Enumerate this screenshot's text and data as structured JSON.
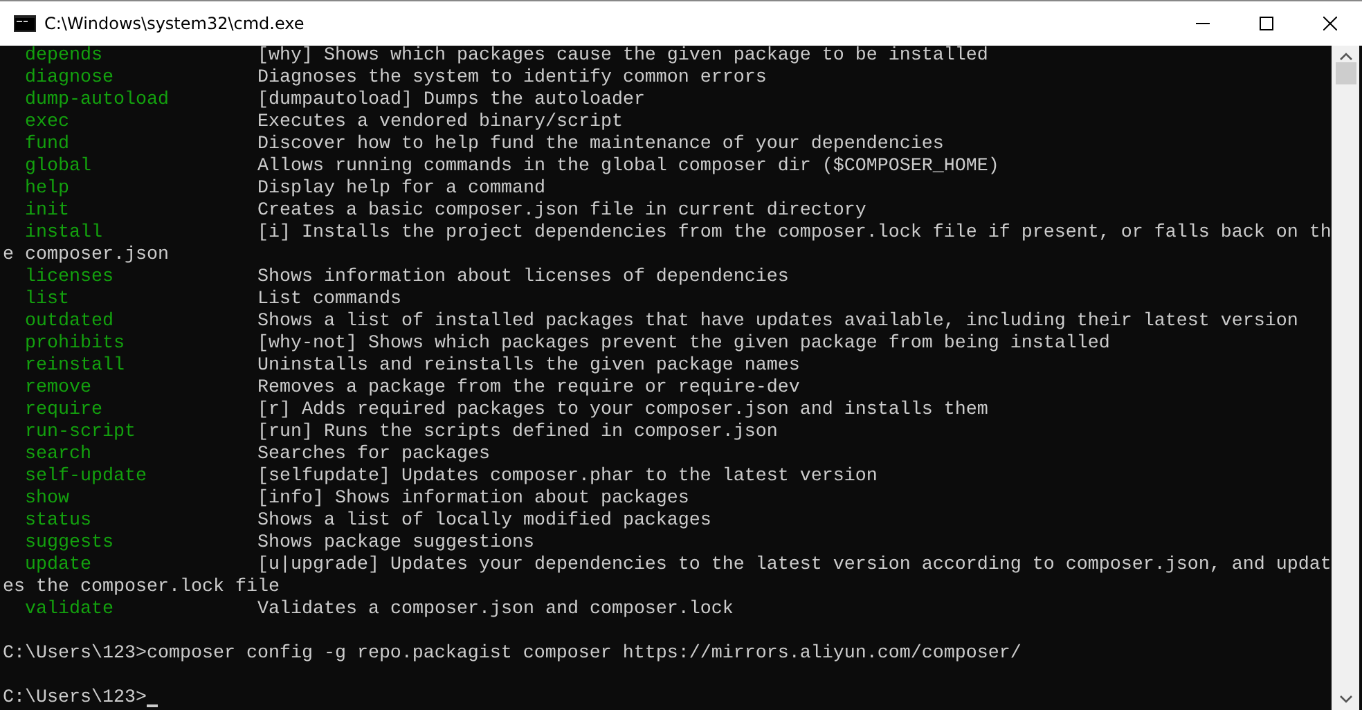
{
  "window": {
    "title": "C:\\Windows\\system32\\cmd.exe"
  },
  "console": {
    "lines": [
      {
        "kind": "command",
        "name": "depends",
        "description": "[why] Shows which packages cause the given package to be installed"
      },
      {
        "kind": "command",
        "name": "diagnose",
        "description": "Diagnoses the system to identify common errors"
      },
      {
        "kind": "command",
        "name": "dump-autoload",
        "description": "[dumpautoload] Dumps the autoloader"
      },
      {
        "kind": "command",
        "name": "exec",
        "description": "Executes a vendored binary/script"
      },
      {
        "kind": "command",
        "name": "fund",
        "description": "Discover how to help fund the maintenance of your dependencies"
      },
      {
        "kind": "command",
        "name": "global",
        "description": "Allows running commands in the global composer dir ($COMPOSER_HOME)"
      },
      {
        "kind": "command",
        "name": "help",
        "description": "Display help for a command"
      },
      {
        "kind": "command",
        "name": "init",
        "description": "Creates a basic composer.json file in current directory"
      },
      {
        "kind": "command",
        "name": "install",
        "description": "[i] Installs the project dependencies from the composer.lock file if present, or falls back on th"
      },
      {
        "kind": "text",
        "text": "e composer.json"
      },
      {
        "kind": "command",
        "name": "licenses",
        "description": "Shows information about licenses of dependencies"
      },
      {
        "kind": "command",
        "name": "list",
        "description": "List commands"
      },
      {
        "kind": "command",
        "name": "outdated",
        "description": "Shows a list of installed packages that have updates available, including their latest version"
      },
      {
        "kind": "command",
        "name": "prohibits",
        "description": "[why-not] Shows which packages prevent the given package from being installed"
      },
      {
        "kind": "command",
        "name": "reinstall",
        "description": "Uninstalls and reinstalls the given package names"
      },
      {
        "kind": "command",
        "name": "remove",
        "description": "Removes a package from the require or require-dev"
      },
      {
        "kind": "command",
        "name": "require",
        "description": "[r] Adds required packages to your composer.json and installs them"
      },
      {
        "kind": "command",
        "name": "run-script",
        "description": "[run] Runs the scripts defined in composer.json"
      },
      {
        "kind": "command",
        "name": "search",
        "description": "Searches for packages"
      },
      {
        "kind": "command",
        "name": "self-update",
        "description": "[selfupdate] Updates composer.phar to the latest version"
      },
      {
        "kind": "command",
        "name": "show",
        "description": "[info] Shows information about packages"
      },
      {
        "kind": "command",
        "name": "status",
        "description": "Shows a list of locally modified packages"
      },
      {
        "kind": "command",
        "name": "suggests",
        "description": "Shows package suggestions"
      },
      {
        "kind": "command",
        "name": "update",
        "description": "[u|upgrade] Updates your dependencies to the latest version according to composer.json, and updat"
      },
      {
        "kind": "text",
        "text": "es the composer.lock file"
      },
      {
        "kind": "command",
        "name": "validate",
        "description": "Validates a composer.json and composer.lock"
      },
      {
        "kind": "blank"
      },
      {
        "kind": "prompt",
        "text": "C:\\Users\\123>composer config -g repo.packagist composer https://mirrors.aliyun.com/composer/"
      },
      {
        "kind": "blank"
      },
      {
        "kind": "prompt",
        "text": "C:\\Users\\123>",
        "cursor": true
      }
    ]
  }
}
